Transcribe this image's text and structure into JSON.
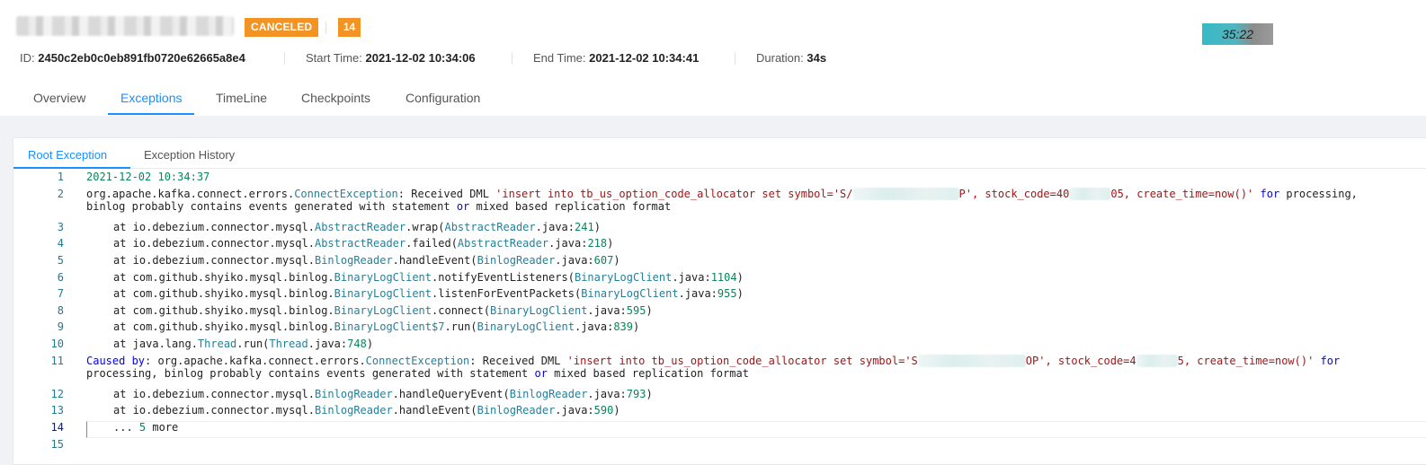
{
  "header": {
    "status": "CANCELED",
    "count": "14",
    "timer": "35:22",
    "meta": {
      "id_label": "ID:",
      "id_value": "2450c2eb0c0eb891fb0720e62665a8e4",
      "start_label": "Start Time:",
      "start_value": "2021-12-02 10:34:06",
      "end_label": "End Time:",
      "end_value": "2021-12-02 10:34:41",
      "duration_label": "Duration:",
      "duration_value": "34s"
    }
  },
  "tabs": [
    "Overview",
    "Exceptions",
    "TimeLine",
    "Checkpoints",
    "Configuration"
  ],
  "active_tab": "Exceptions",
  "subtabs": [
    "Root Exception",
    "Exception History"
  ],
  "active_subtab": "Root Exception",
  "code": {
    "line_numbers": [
      "1",
      "2",
      "3",
      "4",
      "5",
      "6",
      "7",
      "8",
      "9",
      "10",
      "11",
      "12",
      "13",
      "14",
      "15"
    ],
    "l1": "2021-12-02 10:34:37",
    "l2": {
      "pkg": "org.apache.kafka.connect.errors.",
      "cls": "ConnectException",
      "msg": ": Received DML ",
      "s1": "'insert into tb_us_option_code_allocator set symbol='S/",
      "s2": "P', stock_code=40",
      "s3": "05, create_time=now()'",
      "kw_for": " for",
      "tail": " processing,"
    },
    "l2b": {
      "a": "binlog probably contains events generated with statement ",
      "kw_or": "or",
      "b": " mixed based replication format"
    },
    "l3": {
      "pre": "at io.debezium.connector.mysql.",
      "cls": "AbstractReader",
      "mid": ".wrap(",
      "cls2": "AbstractReader",
      "file": ".java:",
      "num": "241",
      "end": ")"
    },
    "l4": {
      "pre": "at io.debezium.connector.mysql.",
      "cls": "AbstractReader",
      "mid": ".failed(",
      "cls2": "AbstractReader",
      "file": ".java:",
      "num": "218",
      "end": ")"
    },
    "l5": {
      "pre": "at io.debezium.connector.mysql.",
      "cls": "BinlogReader",
      "mid": ".handleEvent(",
      "cls2": "BinlogReader",
      "file": ".java:",
      "num": "607",
      "end": ")"
    },
    "l6": {
      "pre": "at com.github.shyiko.mysql.binlog.",
      "cls": "BinaryLogClient",
      "mid": ".notifyEventListeners(",
      "cls2": "BinaryLogClient",
      "file": ".java:",
      "num": "1104",
      "end": ")"
    },
    "l7": {
      "pre": "at com.github.shyiko.mysql.binlog.",
      "cls": "BinaryLogClient",
      "mid": ".listenForEventPackets(",
      "cls2": "BinaryLogClient",
      "file": ".java:",
      "num": "955",
      "end": ")"
    },
    "l8": {
      "pre": "at com.github.shyiko.mysql.binlog.",
      "cls": "BinaryLogClient",
      "mid": ".connect(",
      "cls2": "BinaryLogClient",
      "file": ".java:",
      "num": "595",
      "end": ")"
    },
    "l9": {
      "pre": "at com.github.shyiko.mysql.binlog.",
      "cls": "BinaryLogClient$7",
      "mid": ".run(",
      "cls2": "BinaryLogClient",
      "file": ".java:",
      "num": "839",
      "end": ")"
    },
    "l10": {
      "pre": "at java.lang.",
      "cls": "Thread",
      "mid": ".run(",
      "cls2": "Thread",
      "file": ".java:",
      "num": "748",
      "end": ")"
    },
    "l11": {
      "caused": "Caused by",
      "pkg": ": org.apache.kafka.connect.errors.",
      "cls": "ConnectException",
      "msg": ": Received DML ",
      "s1": "'insert into tb_us_option_code_allocator set symbol='S",
      "s2": "OP', stock_code=4",
      "s3": "5, create_time=now()'",
      "kw_for": " for"
    },
    "l11b": {
      "a": "processing, binlog probably contains events generated with statement ",
      "kw_or": "or",
      "b": " mixed based replication format"
    },
    "l12": {
      "pre": "at io.debezium.connector.mysql.",
      "cls": "BinlogReader",
      "mid": ".handleQueryEvent(",
      "cls2": "BinlogReader",
      "file": ".java:",
      "num": "793",
      "end": ")"
    },
    "l13": {
      "pre": "at io.debezium.connector.mysql.",
      "cls": "BinlogReader",
      "mid": ".handleEvent(",
      "cls2": "BinlogReader",
      "file": ".java:",
      "num": "590",
      "end": ")"
    },
    "l14": {
      "pre": "... ",
      "num": "5",
      "end": " more"
    }
  }
}
